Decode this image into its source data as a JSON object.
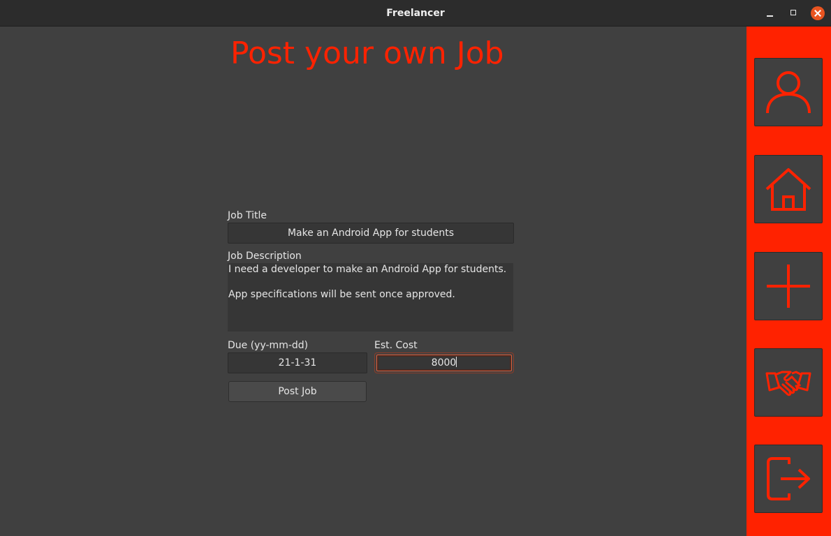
{
  "window": {
    "title": "Freelancer"
  },
  "page": {
    "title": "Post your own Job"
  },
  "form": {
    "job_title_label": "Job Title",
    "job_title_value": "Make an Android App for students",
    "job_description_label": "Job Description",
    "job_description_value": "I need a developer to make an Android App for students.\n\nApp specifications will be sent once approved.",
    "due_label": "Due (yy-mm-dd)",
    "due_value": "21-1-31",
    "cost_label": "Est. Cost",
    "cost_value": "8000",
    "post_button_label": "Post Job"
  },
  "sidebar": {
    "items": [
      {
        "icon": "user-icon"
      },
      {
        "icon": "home-icon"
      },
      {
        "icon": "plus-icon"
      },
      {
        "icon": "handshake-icon"
      },
      {
        "icon": "logout-icon"
      }
    ]
  },
  "colors": {
    "accent": "#ff2200",
    "background": "#404040",
    "titlebar": "#2c2c2c",
    "close_button": "#e95420"
  }
}
